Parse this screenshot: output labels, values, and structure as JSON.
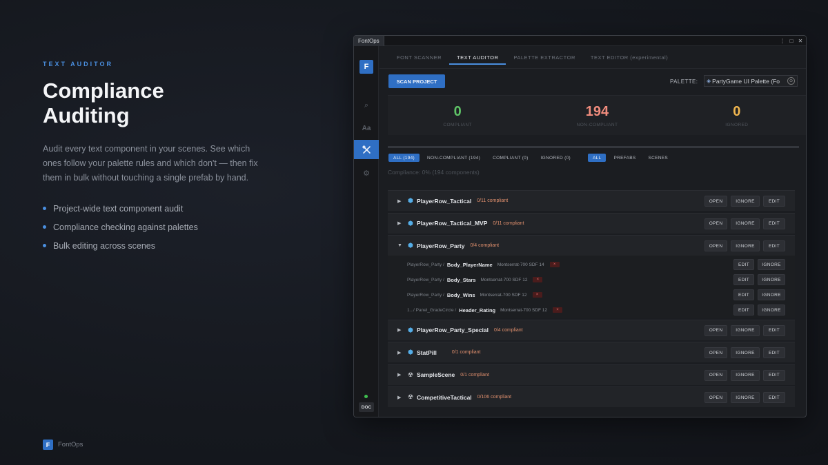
{
  "hero": {
    "eyebrow": "TEXT AUDITOR",
    "title_line1": "Compliance",
    "title_line2": "Auditing",
    "description": "Audit every text component in your scenes. See which ones follow your palette rules and which don't — then fix them in bulk without touching a single prefab by hand.",
    "bullets": [
      "Project-wide text component audit",
      "Compliance checking against palettes",
      "Bulk editing across scenes"
    ]
  },
  "footer": {
    "logo": "F",
    "name": "FontOps"
  },
  "window": {
    "tab_title": "FontOps",
    "controls": {
      "menu": "⋮",
      "maximize": "🗖",
      "close": "✕"
    }
  },
  "sidebar": {
    "logo": "F",
    "items": [
      {
        "icon": "search-icon",
        "glyph": "⌕"
      },
      {
        "icon": "font-icon",
        "glyph": "Aa"
      },
      {
        "icon": "tools-icon",
        "glyph": "✂"
      },
      {
        "icon": "gear-icon",
        "glyph": "⚙"
      }
    ],
    "status_color": "#3fbf4f",
    "doc_label": "DOC"
  },
  "tabs": [
    {
      "label": "FONT SCANNER",
      "active": false
    },
    {
      "label": "TEXT AUDITOR",
      "active": true
    },
    {
      "label": "PALETTE EXTRACTOR",
      "active": false
    },
    {
      "label": "TEXT EDITOR (experimental)",
      "active": false
    }
  ],
  "toolbar": {
    "scan_label": "SCAN PROJECT",
    "palette_label": "PALETTE:",
    "palette_value": "PartyGame UI Palette (Fo"
  },
  "stats": [
    {
      "value": "0",
      "label": "COMPLIANT",
      "color": "#5fc467"
    },
    {
      "value": "194",
      "label": "NON-COMPLIANT",
      "color": "#f08c7d"
    },
    {
      "value": "0",
      "label": "IGNORED",
      "color": "#f0b64f"
    }
  ],
  "filters": {
    "status": [
      {
        "label": "ALL (194)",
        "active": true
      },
      {
        "label": "NON-COMPLIANT (194)",
        "active": false
      },
      {
        "label": "COMPLIANT (0)",
        "active": false
      },
      {
        "label": "IGNORED (0)",
        "active": false
      }
    ],
    "source": [
      {
        "label": "ALL",
        "active": true
      },
      {
        "label": "PREFABS",
        "active": false
      },
      {
        "label": "SCENES",
        "active": false
      }
    ]
  },
  "compliance_text": "Compliance: 0% (194 components)",
  "buttons": {
    "open": "OPEN",
    "ignore": "IGNORE",
    "edit": "EDIT",
    "remove": "×"
  },
  "groups": [
    {
      "name": "PlayerRow_Tactical",
      "count": "0/11 compliant",
      "type": "prefab",
      "expanded": false
    },
    {
      "name": "PlayerRow_Tactical_MVP",
      "count": "0/11 compliant",
      "type": "prefab",
      "expanded": false
    },
    {
      "name": "PlayerRow_Party",
      "count": "0/4 compliant",
      "type": "prefab",
      "expanded": true,
      "children": [
        {
          "path": "PlayerRow_Party /",
          "name": "Body_PlayerName",
          "font": "Montserrat-700 SDF 14"
        },
        {
          "path": "PlayerRow_Party /",
          "name": "Body_Stars",
          "font": "Montserrat-700 SDF 12"
        },
        {
          "path": "PlayerRow_Party /",
          "name": "Body_Wins",
          "font": "Montserrat-700 SDF 12"
        },
        {
          "path": "1.../ Panel_GradeCircle /",
          "name": "Header_Rating",
          "font": "Montserrat-700 SDF 12"
        }
      ]
    },
    {
      "name": "PlayerRow_Party_Special",
      "count": "0/4 compliant",
      "type": "prefab",
      "expanded": false
    },
    {
      "name": "StatPill",
      "count": "0/1 compliant",
      "type": "prefab",
      "expanded": false
    },
    {
      "name": "SampleScene",
      "count": "0/1 compliant",
      "type": "scene",
      "expanded": false
    },
    {
      "name": "CompetitiveTactical",
      "count": "0/106 compliant",
      "type": "scene",
      "expanded": false
    }
  ],
  "colors": {
    "accent": "#2f6fc4",
    "warning": "#e1906e"
  }
}
